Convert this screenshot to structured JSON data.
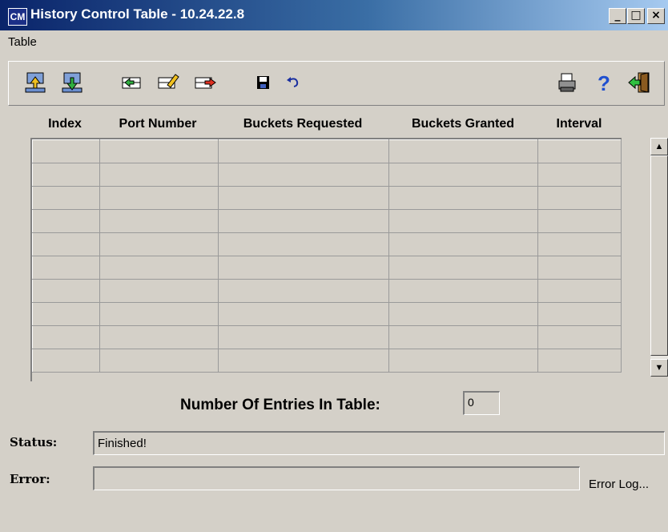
{
  "window": {
    "title": "History Control Table - 10.24.22.8",
    "icon_text": "CM",
    "controls": {
      "minimize": "_",
      "maximize": "□",
      "close": "×"
    }
  },
  "menu": {
    "items": [
      {
        "label": "Table"
      }
    ]
  },
  "toolbar": {
    "buttons": [
      {
        "name": "upload-icon"
      },
      {
        "name": "download-icon"
      },
      {
        "name": "add-row-icon"
      },
      {
        "name": "edit-row-icon"
      },
      {
        "name": "delete-row-icon"
      },
      {
        "name": "save-icon"
      },
      {
        "name": "undo-icon"
      },
      {
        "name": "print-icon"
      },
      {
        "name": "help-icon"
      },
      {
        "name": "exit-icon"
      }
    ]
  },
  "table": {
    "columns": [
      "Index",
      "Port Number",
      "Buckets Requested",
      "Buckets Granted",
      "Interval"
    ],
    "rows": [
      [
        "",
        "",
        "",
        "",
        ""
      ],
      [
        "",
        "",
        "",
        "",
        ""
      ],
      [
        "",
        "",
        "",
        "",
        ""
      ],
      [
        "",
        "",
        "",
        "",
        ""
      ],
      [
        "",
        "",
        "",
        "",
        ""
      ],
      [
        "",
        "",
        "",
        "",
        ""
      ],
      [
        "",
        "",
        "",
        "",
        ""
      ],
      [
        "",
        "",
        "",
        "",
        ""
      ],
      [
        "",
        "",
        "",
        "",
        ""
      ],
      [
        "",
        "",
        "",
        "",
        ""
      ]
    ]
  },
  "entries": {
    "label": "Number Of Entries In Table:",
    "value": "0"
  },
  "status": {
    "label": "Status:",
    "value": "Finished!"
  },
  "error": {
    "label": "Error:",
    "value": "",
    "log_button": "Error Log..."
  },
  "colors": {
    "title_start": "#0a246a",
    "title_end": "#a6caf0",
    "face": "#d4d0c8"
  }
}
